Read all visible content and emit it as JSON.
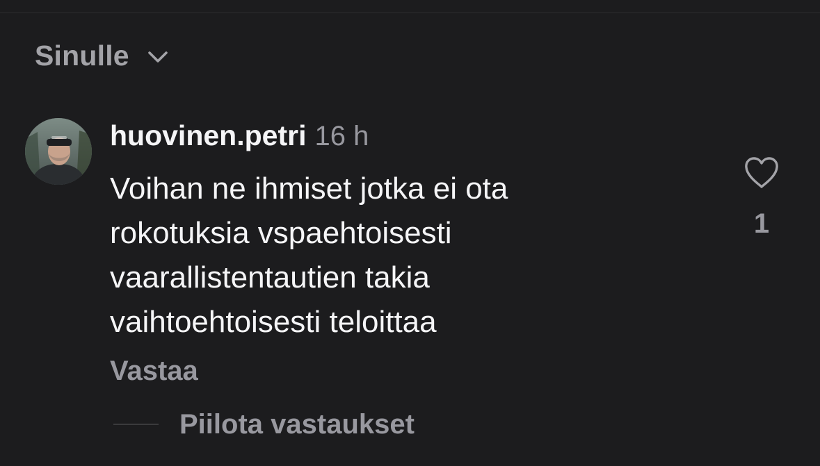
{
  "sort": {
    "label": "Sinulle",
    "icon": "chevron-down-icon"
  },
  "comment": {
    "avatar_icon": "user-avatar",
    "username": "huovinen.petri",
    "timestamp": "16 h",
    "text_lines": [
      "Voihan ne ihmiset jotka ei ota",
      "rokotuksia vspaehtoisesti",
      "vaarallistentautien takia",
      "vaihtoehtoisesti teloittaa"
    ],
    "like_icon": "heart-outline-icon",
    "like_count": "1",
    "reply_label": "Vastaa",
    "hide_replies_label": "Piilota vastaukset"
  },
  "colors": {
    "background": "#1c1c1e",
    "primary_text": "#f5f5f7",
    "secondary_text": "#98989f"
  }
}
